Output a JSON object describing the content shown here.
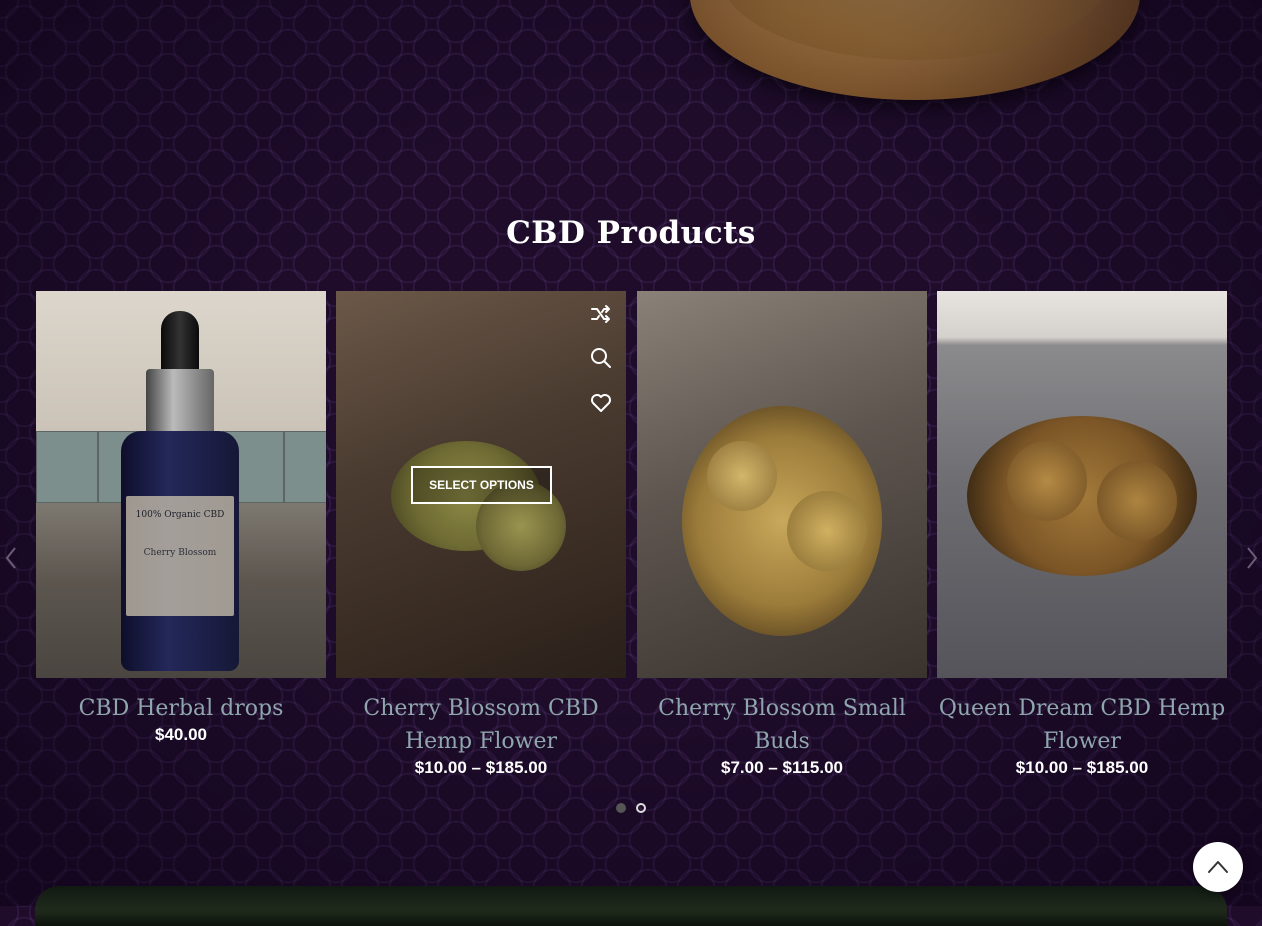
{
  "section": {
    "title": "CBD Products"
  },
  "products": [
    {
      "title": "CBD Herbal drops",
      "price": "$40.00"
    },
    {
      "title": "Cherry Blossom CBD Hemp Flower",
      "price_min": "$10.00",
      "dash": "–",
      "price_max": "$185.00",
      "overlay_button": "SELECT OPTIONS"
    },
    {
      "title": "Cherry Blossom Small Buds",
      "price_min": "$7.00",
      "dash": "–",
      "price_max": "$115.00"
    },
    {
      "title": "Queen Dream CBD Hemp Flower",
      "price_min": "$10.00",
      "dash": "–",
      "price_max": "$185.00"
    }
  ],
  "label_text": {
    "line1": "100% Organic CBD",
    "line2": "Cherry Blossom"
  },
  "icons": {
    "compare": "shuffle-icon",
    "quick_view": "search-icon",
    "wishlist": "heart-icon",
    "prev": "chevron-left-icon",
    "next": "chevron-right-icon",
    "scroll_top": "chevron-up-icon"
  },
  "carousel": {
    "pages": 2,
    "current": 1
  }
}
